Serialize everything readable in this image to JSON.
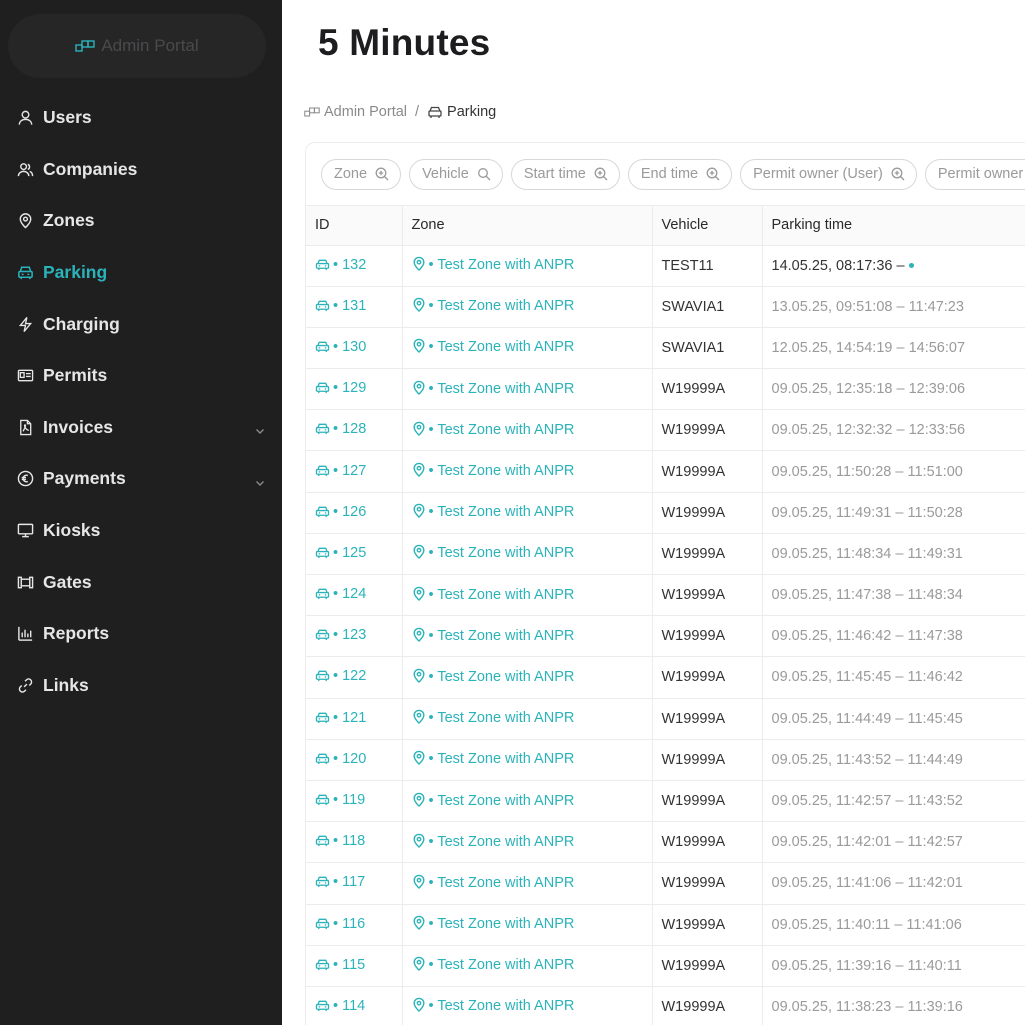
{
  "sidebar": {
    "logo_text": "Admin Portal",
    "items": [
      {
        "label": "Users",
        "icon": "user-icon",
        "active": false,
        "has_submenu": false
      },
      {
        "label": "Companies",
        "icon": "users-group-icon",
        "active": false,
        "has_submenu": false
      },
      {
        "label": "Zones",
        "icon": "location-pin-icon",
        "active": false,
        "has_submenu": false
      },
      {
        "label": "Parking",
        "icon": "car-icon",
        "active": true,
        "has_submenu": false
      },
      {
        "label": "Charging",
        "icon": "lightning-icon",
        "active": false,
        "has_submenu": false
      },
      {
        "label": "Permits",
        "icon": "id-card-icon",
        "active": false,
        "has_submenu": false
      },
      {
        "label": "Invoices",
        "icon": "pdf-file-icon",
        "active": false,
        "has_submenu": true
      },
      {
        "label": "Payments",
        "icon": "euro-circle-icon",
        "active": false,
        "has_submenu": true
      },
      {
        "label": "Kiosks",
        "icon": "desktop-icon",
        "active": false,
        "has_submenu": false
      },
      {
        "label": "Gates",
        "icon": "gate-icon",
        "active": false,
        "has_submenu": false
      },
      {
        "label": "Reports",
        "icon": "bar-chart-icon",
        "active": false,
        "has_submenu": false
      },
      {
        "label": "Links",
        "icon": "link-icon",
        "active": false,
        "has_submenu": false
      }
    ]
  },
  "page": {
    "title": "5 Minutes",
    "breadcrumb": {
      "root": "Admin Portal",
      "separator": "/",
      "current": "Parking"
    }
  },
  "filters": [
    {
      "label": "Zone",
      "icon": "zoom-in-icon"
    },
    {
      "label": "Vehicle",
      "icon": "search-icon"
    },
    {
      "label": "Start time",
      "icon": "zoom-in-icon"
    },
    {
      "label": "End time",
      "icon": "zoom-in-icon"
    },
    {
      "label": "Permit owner (User)",
      "icon": "zoom-in-icon"
    },
    {
      "label": "Permit owner",
      "icon": "zoom-in-icon"
    }
  ],
  "table": {
    "columns": [
      "ID",
      "Zone",
      "Vehicle",
      "Parking time"
    ],
    "rows": [
      {
        "id": "• 132",
        "zone": "• Test Zone with ANPR",
        "vehicle": "TEST11",
        "time": "14.05.25, 08:17:36 –",
        "live": true
      },
      {
        "id": "• 131",
        "zone": "• Test Zone with ANPR",
        "vehicle": "SWAVIA1",
        "time": "13.05.25, 09:51:08 – 11:47:23",
        "live": false
      },
      {
        "id": "• 130",
        "zone": "• Test Zone with ANPR",
        "vehicle": "SWAVIA1",
        "time": "12.05.25, 14:54:19 – 14:56:07",
        "live": false
      },
      {
        "id": "• 129",
        "zone": "• Test Zone with ANPR",
        "vehicle": "W19999A",
        "time": "09.05.25, 12:35:18 – 12:39:06",
        "live": false
      },
      {
        "id": "• 128",
        "zone": "• Test Zone with ANPR",
        "vehicle": "W19999A",
        "time": "09.05.25, 12:32:32 – 12:33:56",
        "live": false
      },
      {
        "id": "• 127",
        "zone": "• Test Zone with ANPR",
        "vehicle": "W19999A",
        "time": "09.05.25, 11:50:28 – 11:51:00",
        "live": false
      },
      {
        "id": "• 126",
        "zone": "• Test Zone with ANPR",
        "vehicle": "W19999A",
        "time": "09.05.25, 11:49:31 – 11:50:28",
        "live": false
      },
      {
        "id": "• 125",
        "zone": "• Test Zone with ANPR",
        "vehicle": "W19999A",
        "time": "09.05.25, 11:48:34 – 11:49:31",
        "live": false
      },
      {
        "id": "• 124",
        "zone": "• Test Zone with ANPR",
        "vehicle": "W19999A",
        "time": "09.05.25, 11:47:38 – 11:48:34",
        "live": false
      },
      {
        "id": "• 123",
        "zone": "• Test Zone with ANPR",
        "vehicle": "W19999A",
        "time": "09.05.25, 11:46:42 – 11:47:38",
        "live": false
      },
      {
        "id": "• 122",
        "zone": "• Test Zone with ANPR",
        "vehicle": "W19999A",
        "time": "09.05.25, 11:45:45 – 11:46:42",
        "live": false
      },
      {
        "id": "• 121",
        "zone": "• Test Zone with ANPR",
        "vehicle": "W19999A",
        "time": "09.05.25, 11:44:49 – 11:45:45",
        "live": false
      },
      {
        "id": "• 120",
        "zone": "• Test Zone with ANPR",
        "vehicle": "W19999A",
        "time": "09.05.25, 11:43:52 – 11:44:49",
        "live": false
      },
      {
        "id": "• 119",
        "zone": "• Test Zone with ANPR",
        "vehicle": "W19999A",
        "time": "09.05.25, 11:42:57 – 11:43:52",
        "live": false
      },
      {
        "id": "• 118",
        "zone": "• Test Zone with ANPR",
        "vehicle": "W19999A",
        "time": "09.05.25, 11:42:01 – 11:42:57",
        "live": false
      },
      {
        "id": "• 117",
        "zone": "• Test Zone with ANPR",
        "vehicle": "W19999A",
        "time": "09.05.25, 11:41:06 – 11:42:01",
        "live": false
      },
      {
        "id": "• 116",
        "zone": "• Test Zone with ANPR",
        "vehicle": "W19999A",
        "time": "09.05.25, 11:40:11 – 11:41:06",
        "live": false
      },
      {
        "id": "• 115",
        "zone": "• Test Zone with ANPR",
        "vehicle": "W19999A",
        "time": "09.05.25, 11:39:16 – 11:40:11",
        "live": false
      },
      {
        "id": "• 114",
        "zone": "• Test Zone with ANPR",
        "vehicle": "W19999A",
        "time": "09.05.25, 11:38:23 – 11:39:16",
        "live": false
      }
    ]
  },
  "colors": {
    "accent": "#2bb3ba",
    "sidebar_bg": "#1f1f20",
    "muted_text": "#9a9a9a"
  }
}
